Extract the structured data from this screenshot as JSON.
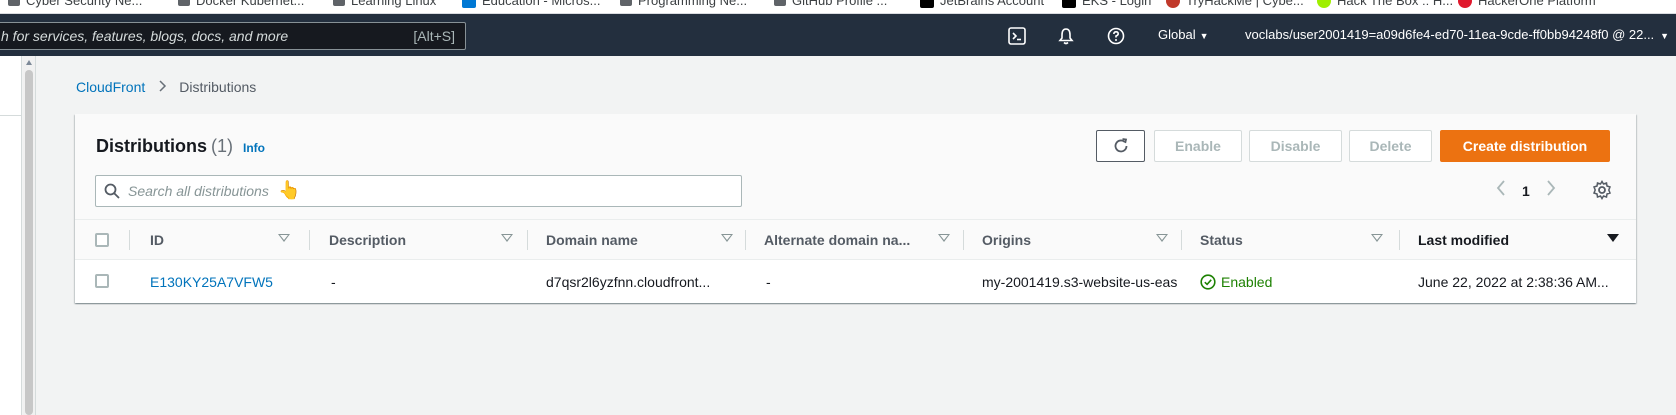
{
  "bookmarks": [
    {
      "label": "Cyber Security Ne...",
      "color": "#5f6368"
    },
    {
      "label": "Docker Kubernet...",
      "color": "#5f6368"
    },
    {
      "label": "Learning Linux",
      "color": "#5f6368"
    },
    {
      "label": "Education - Micros...",
      "color": "#0078d4"
    },
    {
      "label": "Programming Ne...",
      "color": "#5f6368"
    },
    {
      "label": "GitHub Profile ...",
      "color": "#5f6368"
    },
    {
      "label": "JetBrains Account",
      "color": "#000000"
    },
    {
      "label": "EKS - Login",
      "color": "#000000"
    },
    {
      "label": "TryHackMe | Cybe...",
      "color": "#c0392b"
    },
    {
      "label": "Hack The Box :: H...",
      "color": "#9fef00"
    },
    {
      "label": "HackerOne Platform",
      "color": "#e0182d"
    }
  ],
  "topnav": {
    "search_placeholder": "h for services, features, blogs, docs, and more",
    "search_shortcut": "[Alt+S]",
    "region": "Global",
    "account": "voclabs/user2001419=a09d6fe4-ed70-11ea-9cde-ff0bb94248f0 @ 22..."
  },
  "breadcrumb": {
    "root": "CloudFront",
    "current": "Distributions"
  },
  "panel": {
    "title": "Distributions",
    "count": "(1)",
    "info": "Info",
    "buttons": {
      "enable": "Enable",
      "disable": "Disable",
      "delete": "Delete",
      "create": "Create distribution"
    },
    "search_placeholder": "Search all distributions",
    "page": "1"
  },
  "table": {
    "columns": [
      "ID",
      "Description",
      "Domain name",
      "Alternate domain na...",
      "Origins",
      "Status",
      "Last modified"
    ],
    "rows": [
      {
        "id": "E130KY25A7VFW5",
        "description": "-",
        "domain": "d7qsr2l6yzfnn.cloudfront...",
        "alternate": "-",
        "origins": "my-2001419.s3-website-us-eas",
        "status": "Enabled",
        "last_modified": "June 22, 2022 at 2:38:36 AM..."
      }
    ]
  },
  "colors": {
    "nav_bg": "#232f3e",
    "primary": "#ec7211",
    "link": "#0073bb",
    "success": "#1d8102"
  }
}
